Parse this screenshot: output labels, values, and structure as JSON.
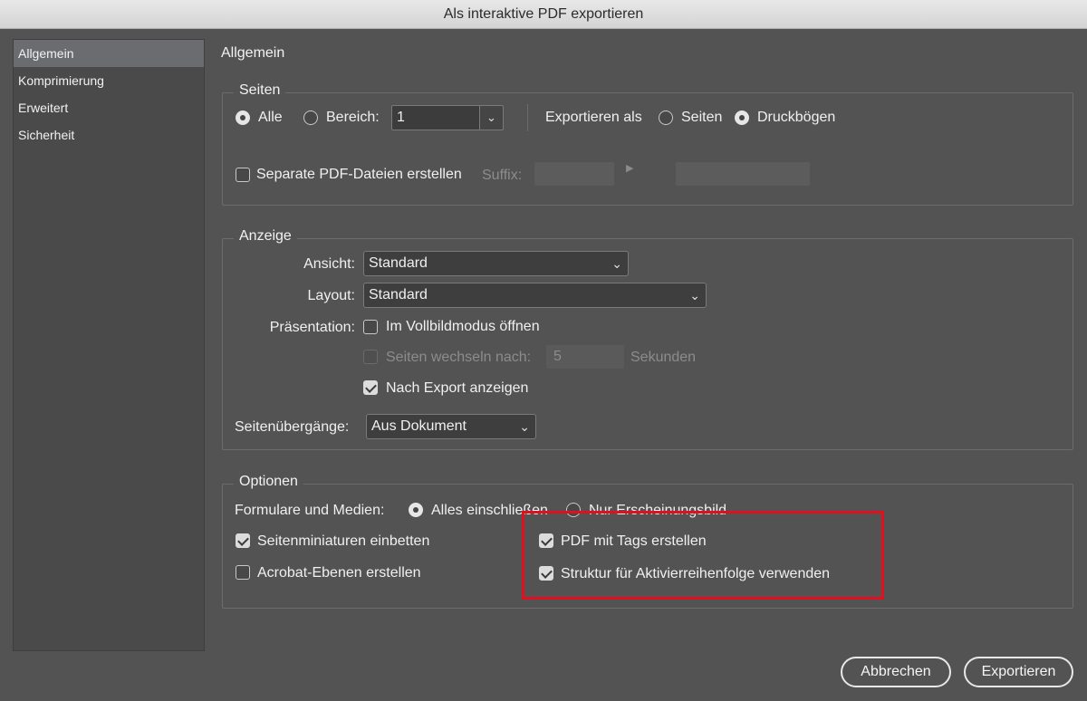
{
  "window": {
    "title": "Als interaktive PDF exportieren"
  },
  "sidebar": {
    "items": [
      {
        "label": "Allgemein",
        "active": true
      },
      {
        "label": "Komprimierung"
      },
      {
        "label": "Erweitert"
      },
      {
        "label": "Sicherheit"
      }
    ]
  },
  "main": {
    "title": "Allgemein"
  },
  "seiten": {
    "legend": "Seiten",
    "alle_label": "Alle",
    "alle_selected": true,
    "bereich_label": "Bereich:",
    "bereich_value": "1",
    "export_als_label": "Exportieren als",
    "seiten_option_label": "Seiten",
    "druckboegen_label": "Druckbögen",
    "druckboegen_selected": true,
    "separate_label": "Separate PDF-Dateien erstellen",
    "separate_checked": false,
    "suffix_label": "Suffix:"
  },
  "anzeige": {
    "legend": "Anzeige",
    "ansicht_label": "Ansicht:",
    "ansicht_value": "Standard",
    "layout_label": "Layout:",
    "layout_value": "Standard",
    "praesentation_label": "Präsentation:",
    "vollbild_label": "Im Vollbildmodus öffnen",
    "vollbild_checked": false,
    "wechseln_label": "Seiten wechseln nach:",
    "wechseln_value": "5",
    "sekunden_label": "Sekunden",
    "nach_export_label": "Nach Export anzeigen",
    "nach_export_checked": true,
    "uebergaenge_label": "Seitenübergänge:",
    "uebergaenge_value": "Aus Dokument"
  },
  "optionen": {
    "legend": "Optionen",
    "formulare_label": "Formulare und Medien:",
    "alles_label": "Alles einschließen",
    "alles_selected": true,
    "nur_label": "Nur Erscheinungsbild",
    "miniaturen_label": "Seitenminiaturen einbetten",
    "miniaturen_checked": true,
    "acrobat_label": "Acrobat-Ebenen erstellen",
    "acrobat_checked": false,
    "tags_label": "PDF mit Tags erstellen",
    "tags_checked": true,
    "struktur_label": "Struktur für Aktivierreihenfolge verwenden",
    "struktur_checked": true
  },
  "footer": {
    "cancel_label": "Abbrechen",
    "export_label": "Exportieren"
  },
  "colors": {
    "highlight": "#e0101e",
    "active_sidebar": "#6a6c70",
    "dialog_bg": "#535353"
  }
}
